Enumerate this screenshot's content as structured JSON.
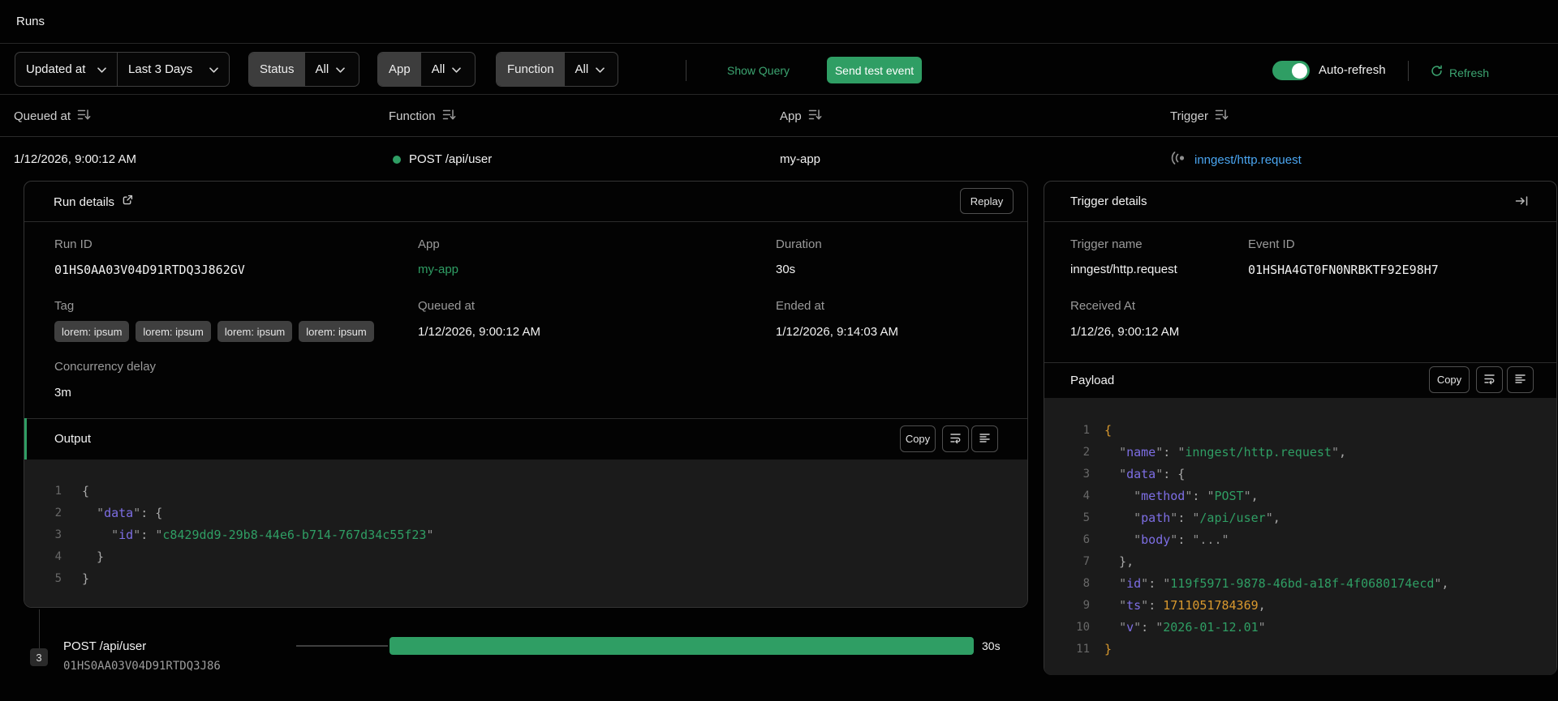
{
  "page": {
    "title": "Runs"
  },
  "filters": {
    "sort_field": "Updated at",
    "time_range": "Last 3 Days",
    "status_label": "Status",
    "status_value": "All",
    "app_label": "App",
    "app_value": "All",
    "function_label": "Function",
    "function_value": "All",
    "show_query": "Show Query",
    "send_test_event": "Send test event",
    "auto_refresh_label": "Auto-refresh",
    "auto_refresh_on": true,
    "refresh_label": "Refresh"
  },
  "table": {
    "columns": [
      "Queued at",
      "Function",
      "App",
      "Trigger"
    ],
    "row": {
      "queued_at": "1/12/2026, 9:00:12 AM",
      "function": "POST /api/user",
      "app": "my-app",
      "trigger": "inngest/http.request"
    }
  },
  "run_details": {
    "title": "Run details",
    "replay": "Replay",
    "fields": {
      "run_id_label": "Run ID",
      "run_id": "01HS0AA03V04D91RTDQ3J862GV",
      "app_label": "App",
      "app": "my-app",
      "duration_label": "Duration",
      "duration": "30s",
      "tag_label": "Tag",
      "tags": [
        "lorem: ipsum",
        "lorem: ipsum",
        "lorem: ipsum",
        "lorem: ipsum"
      ],
      "queued_label": "Queued at",
      "queued": "1/12/2026, 9:00:12 AM",
      "ended_label": "Ended at",
      "ended": "1/12/2026, 9:14:03 AM",
      "concurrency_label": "Concurrency delay",
      "concurrency": "3m"
    },
    "output": {
      "title": "Output",
      "copy": "Copy",
      "code": [
        [
          [
            "p",
            "{"
          ]
        ],
        [
          [
            "p",
            "  "
          ],
          [
            "q",
            "\""
          ],
          [
            "k",
            "data"
          ],
          [
            "q",
            "\""
          ],
          [
            "p",
            ": {"
          ]
        ],
        [
          [
            "p",
            "    "
          ],
          [
            "q",
            "\""
          ],
          [
            "k",
            "id"
          ],
          [
            "q",
            "\""
          ],
          [
            "p",
            ": "
          ],
          [
            "q",
            "\""
          ],
          [
            "s",
            "c8429dd9-29b8-44e6-b714-767d34c55f23"
          ],
          [
            "q",
            "\""
          ]
        ],
        [
          [
            "p",
            "  }"
          ]
        ],
        [
          [
            "p",
            "}"
          ]
        ]
      ]
    }
  },
  "timeline": {
    "count": "3",
    "step_name": "POST /api/user",
    "step_id": "01HS0AA03V04D91RTDQ3J86",
    "duration": "30s"
  },
  "trigger_details": {
    "title": "Trigger details",
    "trigger_name_label": "Trigger name",
    "trigger_name": "inngest/http.request",
    "event_id_label": "Event ID",
    "event_id": "01HSHA4GT0FN0NRBKTF92E98H7",
    "received_label": "Received At",
    "received": "1/12/26, 9:00:12 AM",
    "payload": {
      "title": "Payload",
      "copy": "Copy",
      "code": [
        [
          [
            "b",
            "{"
          ]
        ],
        [
          [
            "p",
            "  "
          ],
          [
            "q",
            "\""
          ],
          [
            "k",
            "name"
          ],
          [
            "q",
            "\""
          ],
          [
            "p",
            ": "
          ],
          [
            "q",
            "\""
          ],
          [
            "s",
            "inngest/http.request"
          ],
          [
            "q",
            "\""
          ],
          [
            "p",
            ","
          ]
        ],
        [
          [
            "p",
            "  "
          ],
          [
            "q",
            "\""
          ],
          [
            "k",
            "data"
          ],
          [
            "q",
            "\""
          ],
          [
            "p",
            ": {"
          ]
        ],
        [
          [
            "p",
            "    "
          ],
          [
            "q",
            "\""
          ],
          [
            "k",
            "method"
          ],
          [
            "q",
            "\""
          ],
          [
            "p",
            ": "
          ],
          [
            "q",
            "\""
          ],
          [
            "s",
            "POST"
          ],
          [
            "q",
            "\""
          ],
          [
            "p",
            ","
          ]
        ],
        [
          [
            "p",
            "    "
          ],
          [
            "q",
            "\""
          ],
          [
            "k",
            "path"
          ],
          [
            "q",
            "\""
          ],
          [
            "p",
            ": "
          ],
          [
            "q",
            "\""
          ],
          [
            "s",
            "/api/user"
          ],
          [
            "q",
            "\""
          ],
          [
            "p",
            ","
          ]
        ],
        [
          [
            "p",
            "    "
          ],
          [
            "q",
            "\""
          ],
          [
            "k",
            "body"
          ],
          [
            "q",
            "\""
          ],
          [
            "p",
            ": "
          ],
          [
            "q",
            "\""
          ],
          [
            "q",
            "..."
          ],
          [
            "q",
            "\""
          ]
        ],
        [
          [
            "p",
            "  },"
          ]
        ],
        [
          [
            "p",
            "  "
          ],
          [
            "q",
            "\""
          ],
          [
            "k",
            "id"
          ],
          [
            "q",
            "\""
          ],
          [
            "p",
            ": "
          ],
          [
            "q",
            "\""
          ],
          [
            "s",
            "119f5971-9878-46bd-a18f-4f0680174ecd"
          ],
          [
            "q",
            "\""
          ],
          [
            "p",
            ","
          ]
        ],
        [
          [
            "p",
            "  "
          ],
          [
            "q",
            "\""
          ],
          [
            "k",
            "ts"
          ],
          [
            "q",
            "\""
          ],
          [
            "p",
            ": "
          ],
          [
            "n",
            "1711051784369"
          ],
          [
            "p",
            ","
          ]
        ],
        [
          [
            "p",
            "  "
          ],
          [
            "q",
            "\""
          ],
          [
            "k",
            "v"
          ],
          [
            "q",
            "\""
          ],
          [
            "p",
            ": "
          ],
          [
            "q",
            "\""
          ],
          [
            "s",
            "2026-01-12.01"
          ],
          [
            "q",
            "\""
          ]
        ],
        [
          [
            "b",
            "}"
          ]
        ]
      ]
    }
  },
  "icons": {
    "sort": "sort-desc",
    "chevron": "chevron-down",
    "external": "external-link",
    "webhook": "webhook",
    "refresh": "refresh",
    "wrap": "wrap-text",
    "align": "align-left",
    "collapse": "arrow-to-bar"
  },
  "colors": {
    "accent_green": "#2f9e64",
    "link_green": "#3ca571",
    "link_blue": "#4aa5f0",
    "code_key": "#7d6ee4",
    "code_string": "#2f9e64",
    "code_number": "#d9992e",
    "code_brace": "#d9992e",
    "code_bg": "#1b1b1b"
  }
}
